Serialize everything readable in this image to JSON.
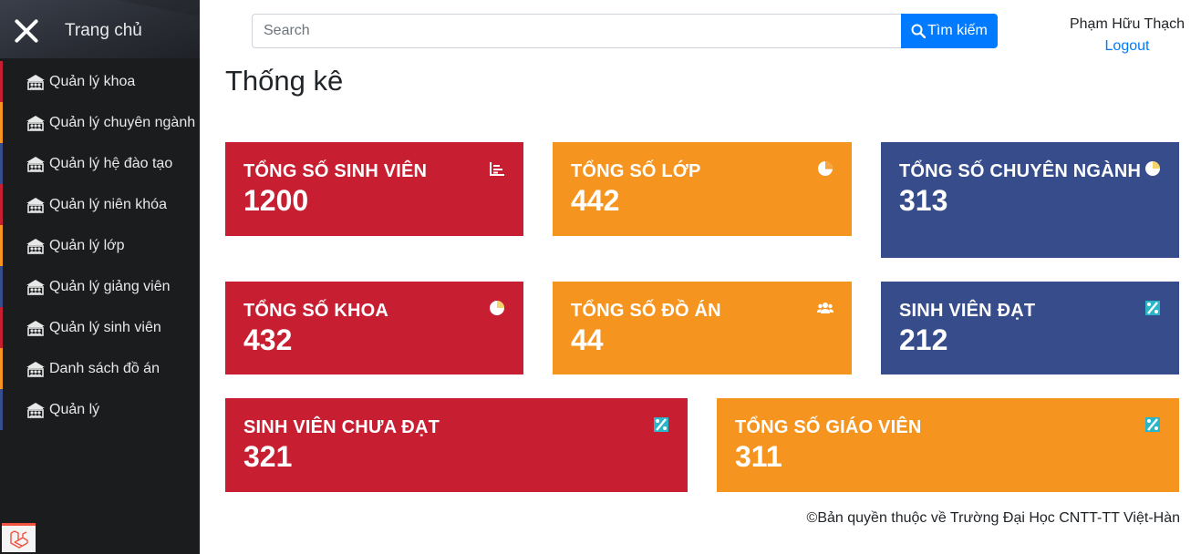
{
  "sidebar": {
    "title": "Trang chủ",
    "close_icon": "close-icon",
    "items": [
      {
        "label": "Quản lý khoa",
        "icon": "school-icon",
        "bar_color": "#c71e31"
      },
      {
        "label": "Quản lý chuyên ngành",
        "icon": "school-icon",
        "bar_color": "#f5951f"
      },
      {
        "label": "Quản lý hệ đào tạo",
        "icon": "school-icon",
        "bar_color": "#374c8a"
      },
      {
        "label": "Quản lý niên khóa",
        "icon": "school-icon",
        "bar_color": "#c71e31"
      },
      {
        "label": "Quản lý lớp",
        "icon": "school-icon",
        "bar_color": "#f5951f"
      },
      {
        "label": "Quản lý giảng viên",
        "icon": "school-icon",
        "bar_color": "#374c8a"
      },
      {
        "label": "Quản lý sinh viên",
        "icon": "school-icon",
        "bar_color": "#c71e31"
      },
      {
        "label": "Danh sách đồ án",
        "icon": "school-icon",
        "bar_color": "#f5951f"
      },
      {
        "label": "Quản lý",
        "icon": "school-icon",
        "bar_color": "#374c8a"
      }
    ],
    "footer_icon": "laravel-logo-icon"
  },
  "search": {
    "placeholder": "Search",
    "button_label": "Tìm kiếm",
    "button_icon": "search-icon"
  },
  "user": {
    "name": "Phạm Hữu Thạch",
    "logout_label": "Logout"
  },
  "page": {
    "title": "Thống kê"
  },
  "colors": {
    "red": "#c71e31",
    "orange": "#f5951f",
    "navy": "#374c8a",
    "primary": "#007bff"
  },
  "stats": [
    {
      "label": "Tổng số sinh viên",
      "value": "1200",
      "icon": "bar-chart-icon",
      "color": "red"
    },
    {
      "label": "Tổng số lớp",
      "value": "442",
      "icon": "pie-chart-icon",
      "color": "orange"
    },
    {
      "label": "Tổng số chuyên ngành",
      "value": "313",
      "icon": "pie-chart-icon",
      "color": "navy"
    },
    {
      "label": "Tổng số khoa",
      "value": "432",
      "icon": "pie-chart-icon",
      "color": "red"
    },
    {
      "label": "Tổng số đồ án",
      "value": "44",
      "icon": "users-icon",
      "color": "orange"
    },
    {
      "label": "Sinh viên đạt",
      "value": "212",
      "icon": "percent-icon",
      "color": "navy"
    },
    {
      "label": "Sinh viên chưa đạt",
      "value": "321",
      "icon": "percent-icon",
      "color": "red"
    },
    {
      "label": "Tổng số giáo viên",
      "value": "311",
      "icon": "percent-icon",
      "color": "orange"
    }
  ],
  "footer": {
    "text": "©Bản quyền thuộc về Trường Đại Học CNTT-TT Việt-Hàn"
  }
}
